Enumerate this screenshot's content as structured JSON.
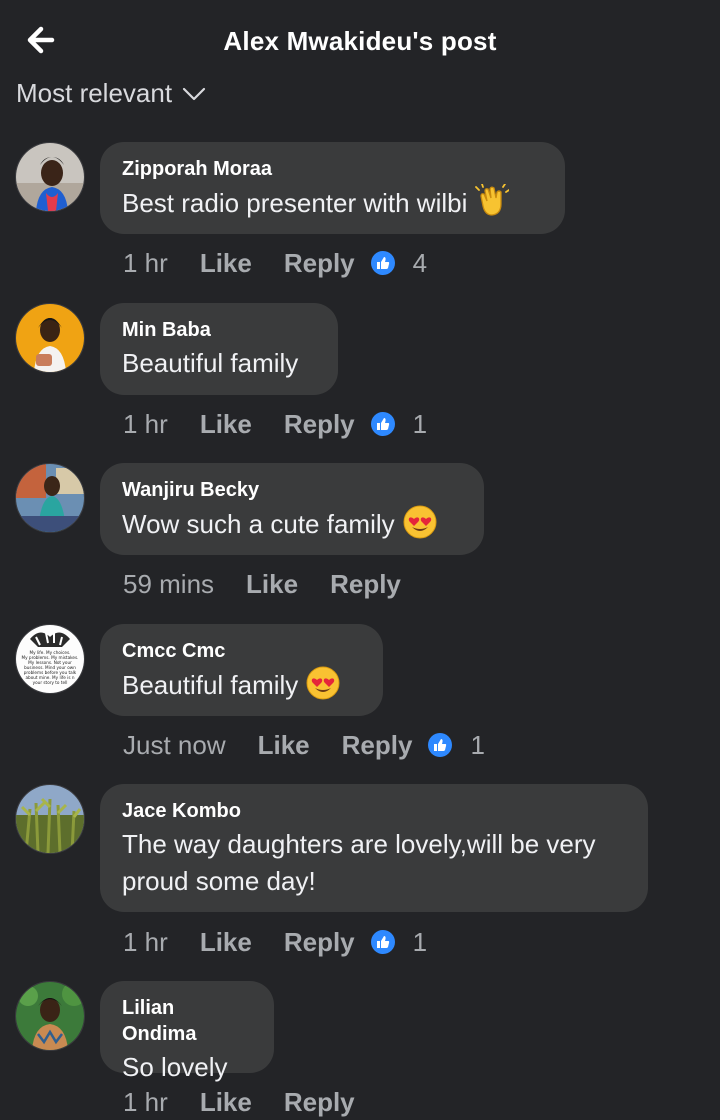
{
  "header": {
    "title": "Alex Mwakideu's post"
  },
  "sort": {
    "label": "Most relevant"
  },
  "colors": {
    "background": "#232427",
    "bubble": "#3a3b3c",
    "reaction_blue": "#2e89ff",
    "muted_text": "#a8abaf"
  },
  "comments": [
    {
      "author": "Zipporah Moraa",
      "text": "Best radio presenter with wilbi",
      "emoji": "clapping-hands",
      "time": "1 hr",
      "like": "Like",
      "reply": "Reply",
      "reactions": "4"
    },
    {
      "author": "Min Baba",
      "text": "Beautiful family",
      "time": "1 hr",
      "like": "Like",
      "reply": "Reply",
      "reactions": "1"
    },
    {
      "author": "Wanjiru Becky",
      "text": "Wow such a cute family",
      "emoji": "heart-eyes",
      "time": "59 mins",
      "like": "Like",
      "reply": "Reply"
    },
    {
      "author": "Cmcc Cmc",
      "text": "Beautiful family",
      "emoji": "heart-eyes",
      "time": "Just now",
      "like": "Like",
      "reply": "Reply",
      "reactions": "1"
    },
    {
      "author": "Jace Kombo",
      "text_lines": [
        "The way daughters are lovely,will be very",
        "proud some day!"
      ],
      "time": "1 hr",
      "like": "Like",
      "reply": "Reply",
      "reactions": "1"
    },
    {
      "author": "Lilian Ondima",
      "text": "So lovely",
      "time": "1 hr",
      "like": "Like",
      "reply": "Reply"
    }
  ],
  "avatar_quote_lines": [
    "My life. My choices.",
    "My problems. My mistakes.",
    "My lessons. Not your",
    "business. Mind your own",
    "problems before you talk",
    "about mine. My life is n",
    "your story to tell"
  ]
}
